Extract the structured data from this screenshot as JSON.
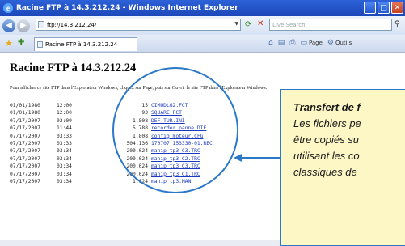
{
  "window": {
    "title": "Racine FTP à 14.3.212.24 - Windows Internet Explorer",
    "logo": "e",
    "buttons": [
      "minimize-icon",
      "maximize-icon",
      "close-icon"
    ]
  },
  "address_bar": {
    "url": "ftp://14.3.212.24/",
    "search_placeholder": "Live Search"
  },
  "tabs": {
    "active_tab_label": "Racine FTP à 14.3.212.24",
    "toolbar": {
      "page_label": "Page",
      "tools_label": "Outils"
    }
  },
  "page": {
    "heading": "Racine FTP à 14.3.212.24",
    "instruction": "Pour afficher ce site FTP dans l'Explorateur Windows, cliquez sur Page, puis sur Ouvrir le site FTP dans l'Explorateur Windows.",
    "files": [
      {
        "date": "01/01/1980",
        "time": "12:00",
        "size": "15",
        "name": "CIMUDLG2.FCT"
      },
      {
        "date": "01/01/1980",
        "time": "12:00",
        "size": "93",
        "name": "SQUARE.FCT"
      },
      {
        "date": "07/17/2007",
        "time": "02:09",
        "size": "1,808",
        "name": "DEF_TUR.INI"
      },
      {
        "date": "07/17/2007",
        "time": "11:44",
        "size": "5,788",
        "name": "recorder_panne.DIF"
      },
      {
        "date": "07/17/2007",
        "time": "03:33",
        "size": "1,808",
        "name": "config moteur.CFG"
      },
      {
        "date": "07/17/2007",
        "time": "03:33",
        "size": "504,136",
        "name": "170707_153330-01.REC"
      },
      {
        "date": "07/17/2007",
        "time": "03:34",
        "size": "200,024",
        "name": "manip_tp3_C3.TRC"
      },
      {
        "date": "07/17/2007",
        "time": "03:34",
        "size": "200,024",
        "name": "manip_tp3_C2.TRC"
      },
      {
        "date": "07/17/2007",
        "time": "03:34",
        "size": "200,024",
        "name": "manip_tp3_C3.TRC"
      },
      {
        "date": "07/17/2007",
        "time": "03:34",
        "size": "200,024",
        "name": "manip_tp3_C1.TRC"
      },
      {
        "date": "07/17/2007",
        "time": "03:34",
        "size": "1,024",
        "name": "manip_tp3.MAN"
      }
    ]
  },
  "callout": {
    "title": "Transfert de f",
    "lines": [
      "Les fichiers pe",
      "être copiés su",
      "utilisant les co",
      "classiques de"
    ]
  }
}
